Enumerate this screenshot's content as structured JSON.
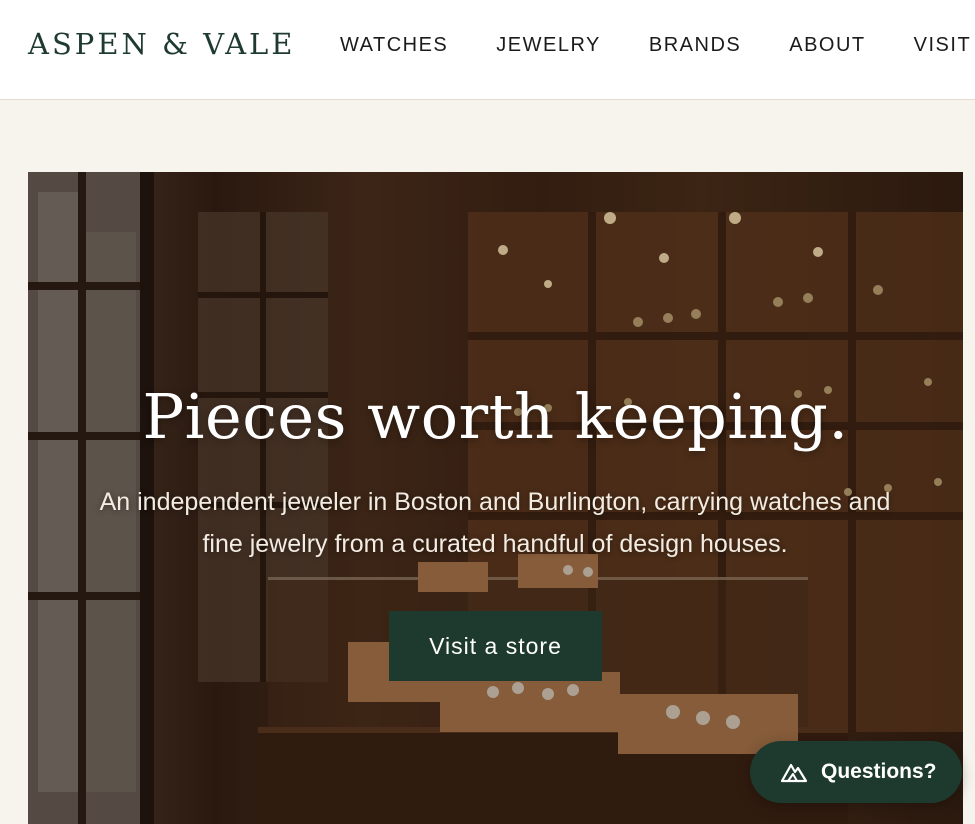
{
  "header": {
    "logo": "ASPEN & VALE",
    "nav": [
      "WATCHES",
      "JEWELRY",
      "BRANDS",
      "ABOUT",
      "VISIT"
    ]
  },
  "hero": {
    "title": "Pieces worth keeping.",
    "subtitle": "An independent jeweler in Boston and Burlington, carrying watches and fine jewelry from a curated handful of design houses.",
    "cta_label": "Visit a store"
  },
  "chat": {
    "label": "Questions?",
    "icon": "mountain-chat-icon"
  },
  "colors": {
    "brand": "#1e3a2f",
    "page_bg": "#f7f4ed",
    "header_bg": "#ffffff"
  }
}
